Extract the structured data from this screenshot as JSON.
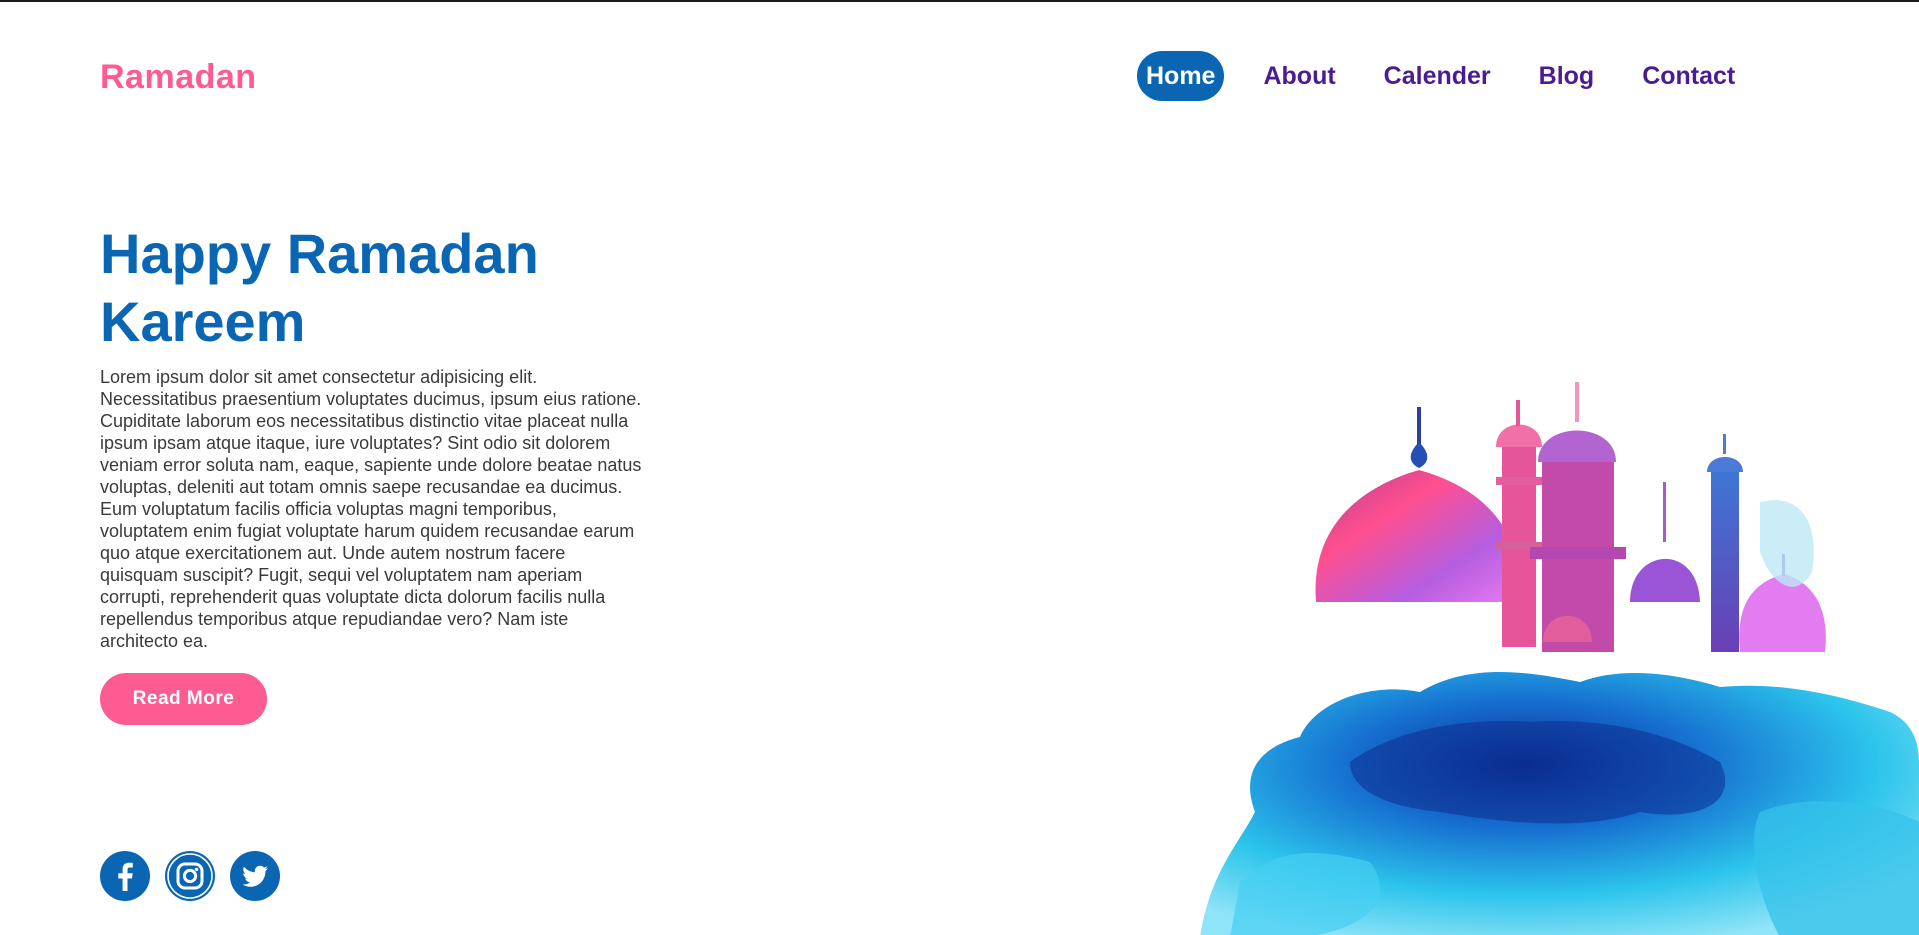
{
  "brand": {
    "name": "Ramadan"
  },
  "nav": {
    "items": [
      {
        "label": "Home",
        "active": true
      },
      {
        "label": "About"
      },
      {
        "label": "Calender"
      },
      {
        "label": "Blog"
      },
      {
        "label": "Contact"
      }
    ]
  },
  "hero": {
    "title": "Happy Ramadan Kareem",
    "body": "Lorem ipsum dolor sit amet consectetur adipisicing elit. Necessitatibus praesentium voluptates ducimus, ipsum eius ratione. Cupiditate laborum eos necessitatibus distinctio vitae placeat nulla ipsum ipsam atque itaque, iure voluptates? Sint odio sit dolorem veniam error soluta nam, eaque, sapiente unde dolore beatae natus voluptas, deleniti aut totam omnis saepe recusandae ea ducimus. Eum voluptatum facilis officia voluptas magni temporibus, voluptatem enim fugiat voluptate harum quidem recusandae earum quo atque exercitationem aut. Unde autem nostrum facere quisquam suscipit? Fugit, sequi vel voluptatem nam aperiam corrupti, reprehenderit quas voluptate dicta dolorum facilis nulla repellendus temporibus atque repudiandae vero? Nam iste architecto ea.",
    "button_label": "Read More"
  },
  "social": {
    "icons": [
      "facebook-icon",
      "instagram-icon",
      "twitter-icon"
    ]
  },
  "colors": {
    "brand_pink": "#ff5b93",
    "primary_blue": "#0a66b3",
    "nav_purple": "#4a1c93",
    "body_text": "#3a3a3a"
  }
}
